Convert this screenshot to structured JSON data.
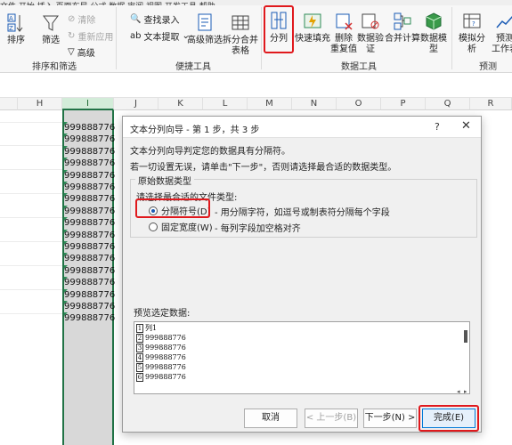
{
  "ribbon": {
    "top_strip": "文件  开始  插入  页面布局  公式  数据  审阅  视图  开发工具  帮助",
    "sort_label": "排序",
    "filter_label": "筛选",
    "clear_label": "清除",
    "reapply_label": "重新应用",
    "advanced_label": "高级",
    "find_entry_label": "查找录入",
    "text_extract_label": "文本提取",
    "advanced_filter_label": "高级筛选",
    "split_merge_label_1": "拆分合并",
    "split_merge_label_2": "表格",
    "text_to_columns_label": "分列",
    "flash_fill_label": "快速填充",
    "remove_dup_label_1": "删除",
    "remove_dup_label_2": "重复值",
    "data_validation_label_1": "数据验",
    "data_validation_label_2": "证",
    "consolidate_label": "合并计算",
    "data_model_label_1": "数据模",
    "data_model_label_2": "型",
    "what_if_label": "模拟分析",
    "forecast_label_1": "预测",
    "forecast_label_2": "工作表",
    "group_sort_filter": "排序和筛选",
    "group_convenience": "便捷工具",
    "group_data_tools": "数据工具",
    "group_forecast": "预测"
  },
  "sheet": {
    "columns": [
      "H",
      "I",
      "J",
      "K",
      "L",
      "M",
      "N",
      "O",
      "P",
      "Q",
      "R"
    ],
    "cell_values": [
      "999888776",
      "999888776",
      "999888776",
      "999888776",
      "999888776",
      "999888776",
      "999888776",
      "999888776",
      "999888776",
      "999888776",
      "999888776",
      "999888776",
      "999888776",
      "999888776",
      "999888776",
      "999888776",
      "999888776"
    ]
  },
  "dialog": {
    "title": "文本分列向导 - 第 1 步，共 3 步",
    "help": "?",
    "close": "✕",
    "line1": "文本分列向导判定您的数据具有分隔符。",
    "line2": "若一切设置无误，请单击\"下一步\"，否则请选择最合适的数据类型。",
    "group_title": "原始数据类型",
    "choose_label": "请选择最合适的文件类型:",
    "option1_label": "分隔符号(D)",
    "option1_desc": "- 用分隔字符，如逗号或制表符分隔每个字段",
    "option2_label": "固定宽度(W)",
    "option2_desc": "- 每列字段加空格对齐",
    "preview_label": "预览选定数据:",
    "preview_rows": [
      {
        "n": "1",
        "text": "列1"
      },
      {
        "n": "2",
        "text": "999888776"
      },
      {
        "n": "3",
        "text": "999888776"
      },
      {
        "n": "4",
        "text": "999888776"
      },
      {
        "n": "5",
        "text": "999888776"
      },
      {
        "n": "6",
        "text": "999888776"
      }
    ],
    "cancel": "取消",
    "back": "< 上一步(B)",
    "next": "下一步(N) >",
    "finish": "完成(E)"
  }
}
